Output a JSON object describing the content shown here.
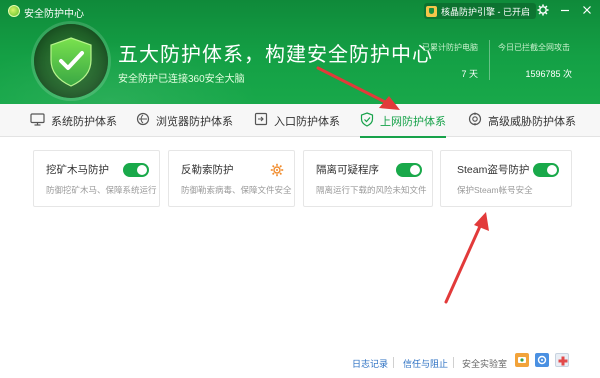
{
  "app": {
    "title": "安全防护中心",
    "engine_badge": "核晶防护引擎 - 已开启"
  },
  "header": {
    "headline": "五大防护体系，构建安全防护中心",
    "subline": "安全防护已连接360安全大脑",
    "stats": [
      {
        "label": "已累计防护电脑",
        "value": "7 天"
      },
      {
        "label": "今日已拦截全网攻击",
        "value": "1596785 次"
      }
    ]
  },
  "tabs": [
    {
      "label": "系统防护体系",
      "icon": "monitor-icon",
      "active": false
    },
    {
      "label": "浏览器防护体系",
      "icon": "browser-icon",
      "active": false
    },
    {
      "label": "入口防护体系",
      "icon": "entrance-icon",
      "active": false
    },
    {
      "label": "上网防护体系",
      "icon": "shield-icon",
      "active": true
    },
    {
      "label": "高级威胁防护体系",
      "icon": "threat-icon",
      "active": false
    }
  ],
  "cards": [
    {
      "title": "挖矿木马防护",
      "desc": "防御挖矿木马、保障系统运行",
      "control": "toggle-on"
    },
    {
      "title": "反勒索防护",
      "desc": "防御勒索病毒、保障文件安全",
      "control": "settings-gear"
    },
    {
      "title": "隔离可疑程序",
      "desc": "隔离运行下载的风险未知文件",
      "control": "toggle-on"
    },
    {
      "title": "Steam盗号防护",
      "desc": "保护Steam帐号安全",
      "control": "toggle-on"
    }
  ],
  "footer": {
    "log_link": "日志记录",
    "trust_link": "信任与阻止",
    "lab_text": "安全实验室"
  },
  "colors": {
    "brand_green": "#17a24a",
    "header_green": "#14a045",
    "annotation_red": "#e23a3a",
    "link_blue": "#2a6fc2"
  }
}
